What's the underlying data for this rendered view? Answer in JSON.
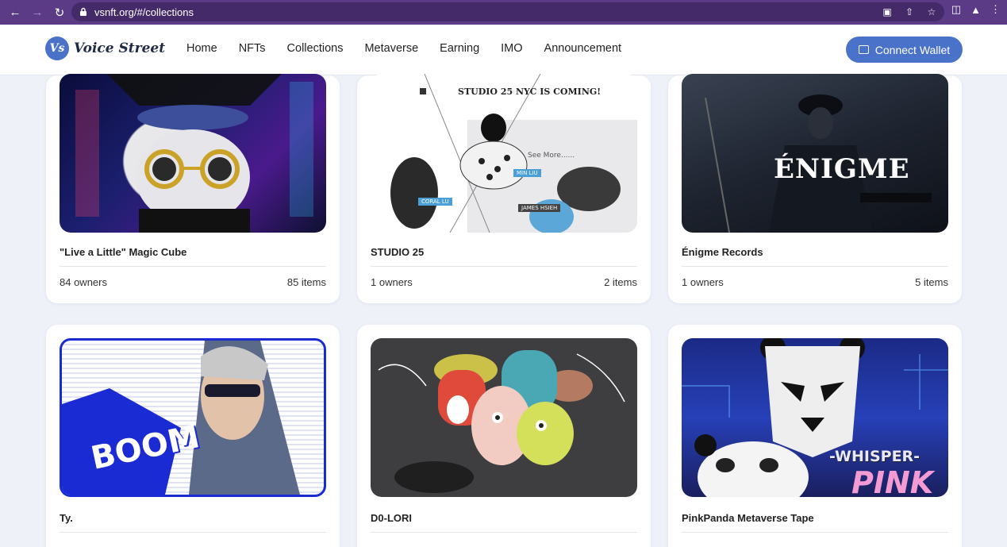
{
  "browser": {
    "url": "vsnft.org/#/collections"
  },
  "site": {
    "logo_mark": "Vs",
    "logo_text": "Voice Street",
    "nav": [
      "Home",
      "NFTs",
      "Collections",
      "Metaverse",
      "Earning",
      "IMO",
      "Announcement"
    ],
    "connect_label": "Connect Wallet"
  },
  "cards": [
    {
      "title": "\"Live a Little\" Magic Cube",
      "owners": "84 owners",
      "items": "85 items"
    },
    {
      "title": "STUDIO 25",
      "owners": "1 owners",
      "items": "2 items",
      "img_heading": "STUDIO 25 NYC IS COMING!",
      "img_see_more": "See More......",
      "img_tags": [
        "MIN LIU",
        "CORAL LU",
        "JAMES HSIEH"
      ]
    },
    {
      "title": "Énigme Records",
      "owners": "1 owners",
      "items": "5 items",
      "img_logo": "ÉNIGME"
    },
    {
      "title": "Ty.",
      "img_word": "BOOM"
    },
    {
      "title": "D0-LORI"
    },
    {
      "title": "PinkPanda Metaverse Tape",
      "img_word": "-WHISPER-",
      "img_word2": "PINK"
    }
  ],
  "colors": {
    "chrome": "#5b3a86",
    "accent": "#4a72c8",
    "page_bg": "#eef1f8"
  }
}
